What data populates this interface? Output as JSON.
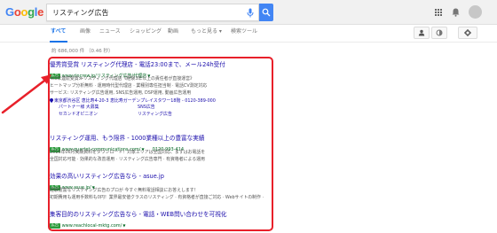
{
  "logo": {
    "text": "Google"
  },
  "search": {
    "query": "リスティング広告"
  },
  "tabs": [
    {
      "label": "すべて"
    },
    {
      "label": "画像"
    },
    {
      "label": "ニュース"
    },
    {
      "label": "ショッピング"
    },
    {
      "label": "動画"
    },
    {
      "label": "もっと見る ▾"
    },
    {
      "label": "検索ツール"
    }
  ],
  "stats": "約 686,000 件 （0.46 秒）",
  "ad_badge": "広告",
  "results": [
    {
      "title": "優秀賞受賞 リスティング代理店 - 電話23:00まで、メール24h受付",
      "url": "www.rincrew.jp/リスティング広告/代理店",
      "desc": [
        "≪3年連続受賞≫リスティング代理店《経験3年以上の責任者が直接運営》",
        "ヒートマップ分析無料 · 運用時代型代理店 · 業種別専任担当制 · 電話CV測定対応",
        "サービス: リスティング広告運用, SNS広告運用, DSP運用, 動画広告運用"
      ],
      "address": "東京都渋谷区 恵比寿4-20-3 恵比寿ガーデンプレイスタワー18階 - 0120-389-000",
      "sitelinks": [
        "パートナー様 大募集",
        "SNS広告",
        "セカンドオピニオン",
        "リスティング広告"
      ]
    },
    {
      "title": "リスティング運用、もう限界 - 1000業種以上の豊富な実績",
      "url": "www.quartet-communications.com/",
      "phone": "0120-993-414",
      "desc": [
        "2016年06月実績資料をダウンロード！対象エリアは全国対応、まずはお電話を",
        "全国対応可能 · 効果的な改善運用 · リスティング広告専門 · 有資格者による運用"
      ]
    },
    {
      "title": "効果の高いリスティング広告なら - asue.jp",
      "url": "www.asue.jp/",
      "desc": [
        "経験豊富なリスティング広告のプロが 今すぐ無料電話相談にお答えします！",
        "初期費用も運用手数料も0円！業界最安値クラスのリスティング · 有資格者が直接ご対応 · Webサイトの制作 ·"
      ]
    },
    {
      "title": "集客目的のリスティング広告なら - 電話・WEB問い合わせを可視化",
      "url": "www.reachlocal-mktg.com/"
    }
  ],
  "colors": {
    "accent_blue": "#4285f4",
    "link": "#1a0dab",
    "url_green": "#006621",
    "highlight_red": "#e8202a"
  },
  "icons": [
    "mic-icon",
    "search-icon",
    "apps-icon",
    "bell-icon",
    "account-icon",
    "list-view-icon",
    "safesearch-icon",
    "gear-icon",
    "pin-icon",
    "arrow-annotation"
  ]
}
